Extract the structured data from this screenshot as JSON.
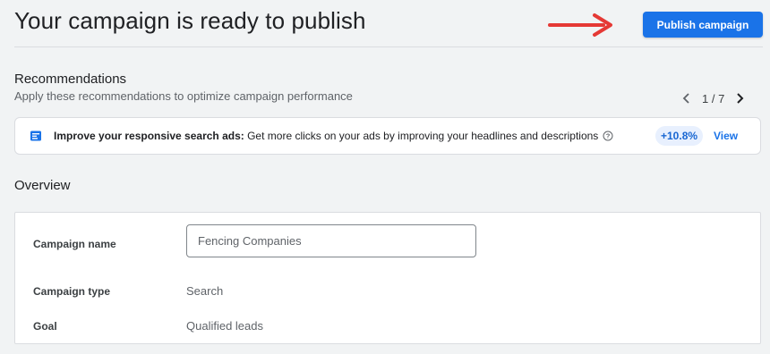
{
  "header": {
    "title": "Your campaign is ready to publish",
    "publish_label": "Publish campaign"
  },
  "recommendations": {
    "title": "Recommendations",
    "subtitle": "Apply these recommendations to optimize campaign performance",
    "pager": "1 / 7",
    "card": {
      "icon": "ad-icon",
      "bold_text": "Improve your responsive search ads:",
      "text": " Get more clicks on your ads by improving your headlines and descriptions",
      "uplift": "+10.8%",
      "action": "View"
    }
  },
  "overview": {
    "title": "Overview",
    "fields": [
      {
        "label": "Campaign name",
        "value": "Fencing Companies"
      },
      {
        "label": "Campaign type",
        "value": "Search"
      },
      {
        "label": "Goal",
        "value": "Qualified leads"
      }
    ]
  },
  "colors": {
    "primary": "#1a73e8",
    "annotation_arrow": "#e53935",
    "background": "#f1f3f4"
  }
}
